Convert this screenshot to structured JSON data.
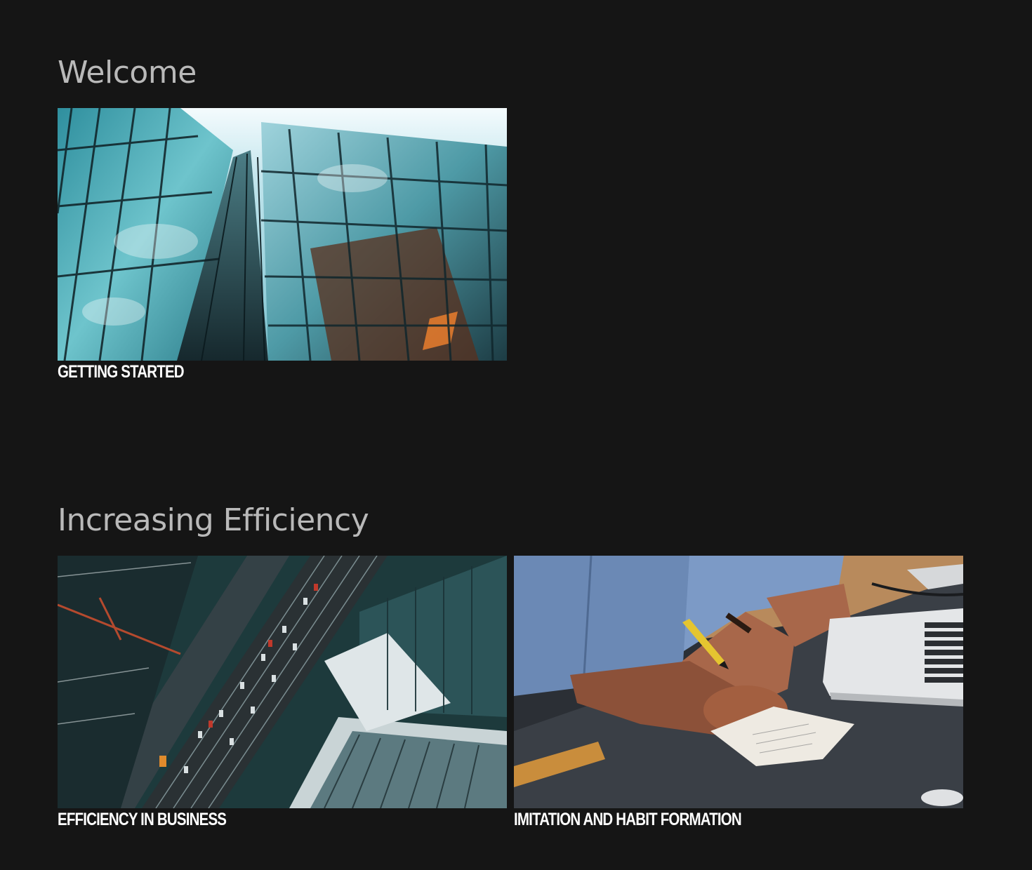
{
  "sections": [
    {
      "title": "Welcome",
      "cards": [
        {
          "caption": "GETTING STARTED",
          "image": "glass-skyscraper-photo"
        }
      ]
    },
    {
      "title": "Increasing Efficiency",
      "cards": [
        {
          "caption": "EFFICIENCY IN BUSINESS",
          "image": "aerial-city-highway-photo"
        },
        {
          "caption": "IMITATION AND HABIT FORMATION",
          "image": "person-writing-at-desk-photo"
        }
      ]
    }
  ],
  "colors": {
    "background": "#151515",
    "heading": "#b9b9b9",
    "caption": "#ffffff"
  }
}
